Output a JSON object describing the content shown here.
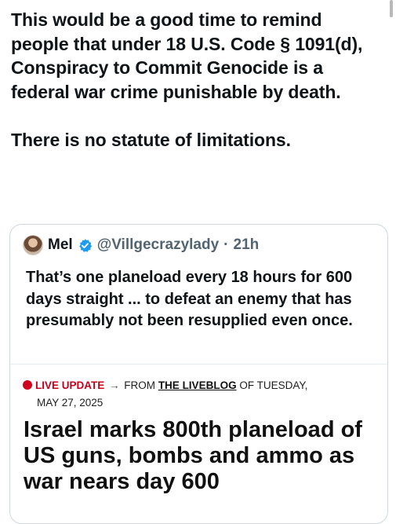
{
  "post": {
    "text": "This would be a good time to remind people that under 18 U.S. Code § 1091(d), Conspiracy to Commit Genocide is a federal war crime punishable by death.\n\nThere is no statute of limitations."
  },
  "quote": {
    "author_name": "Mel",
    "verified_icon": "verified-badge-icon",
    "handle": "@Villgecrazylady",
    "separator": "·",
    "time": "21h",
    "text": "That’s one planeload every 18 hours for 600 days straight ... to defeat an enemy that has presumably not been resupplied even once."
  },
  "article": {
    "live_label": "LIVE UPDATE",
    "arrow": "→",
    "from_text": "FROM",
    "liveblog_link": "THE LIVEBLOG",
    "of_text": "OF TUESDAY,",
    "date": "MAY 27, 2025",
    "headline": "Israel marks 800th planeload of US guns, bombs and ammo as war nears day 600"
  },
  "colors": {
    "verified": "#1d9bf0",
    "live_red": "#d0021b",
    "handle_gray": "#536471"
  }
}
